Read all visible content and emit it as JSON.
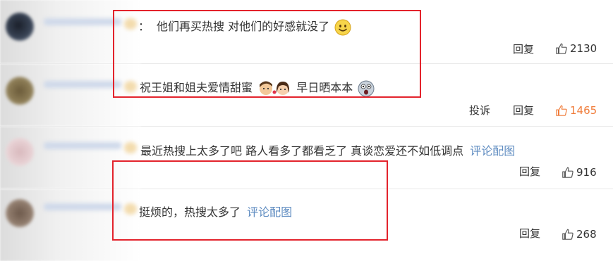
{
  "comments": [
    {
      "text_prefix": "：",
      "text": "他们再买热搜 对他们的好感就没了",
      "actions": [
        "回复"
      ],
      "likes": "2130",
      "likes_hot": false
    },
    {
      "text": "祝王姐和姐夫爱情甜蜜",
      "text2": "早日晒本本",
      "actions": [
        "投诉",
        "回复"
      ],
      "likes": "1465",
      "likes_hot": true
    },
    {
      "text": "最近热搜上太多了吧 路人看多了都看乏了 真谈恋爱还不如低调点",
      "link": "评论配图",
      "actions": [
        "回复"
      ],
      "likes": "916",
      "likes_hot": false
    },
    {
      "text": "挺烦的，热搜太多了",
      "link": "评论配图",
      "actions": [
        "回复"
      ],
      "likes": "268",
      "likes_hot": false
    }
  ],
  "icons": {
    "like": "thumbs-up-icon",
    "smile": "smile-emoji-icon",
    "couple": "couple-emoji-icon",
    "shock": "shock-emoji-icon"
  },
  "colors": {
    "highlight_box": "#e3232c",
    "link": "#5f8cc1",
    "hot_like": "#f07c3a"
  }
}
